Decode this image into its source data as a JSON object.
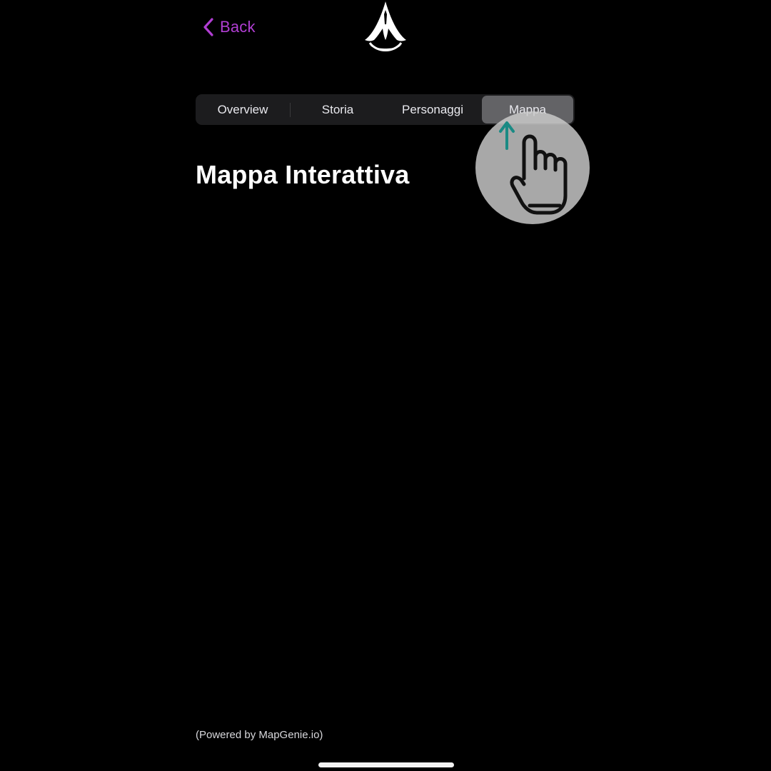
{
  "nav": {
    "back_label": "Back",
    "back_icon": "chevron-left-icon",
    "logo_icon": "assassin-insignia-icon"
  },
  "tabs": [
    {
      "label": "Overview",
      "selected": false
    },
    {
      "label": "Storia",
      "selected": false
    },
    {
      "label": "Personaggi",
      "selected": false
    },
    {
      "label": "Mappa",
      "selected": true
    }
  ],
  "main": {
    "title": "Mappa Interattiva"
  },
  "footer": {
    "credit": "(Powered by MapGenie.io)"
  },
  "overlay": {
    "icon": "hand-pointer-icon",
    "arrow_icon": "arrow-up-icon"
  },
  "colors": {
    "background": "#000000",
    "accent": "#b13ed3",
    "segment_bg": "#1c1c1e",
    "segment_selected": "#636366",
    "overlay_arrow": "#1a8a84"
  }
}
